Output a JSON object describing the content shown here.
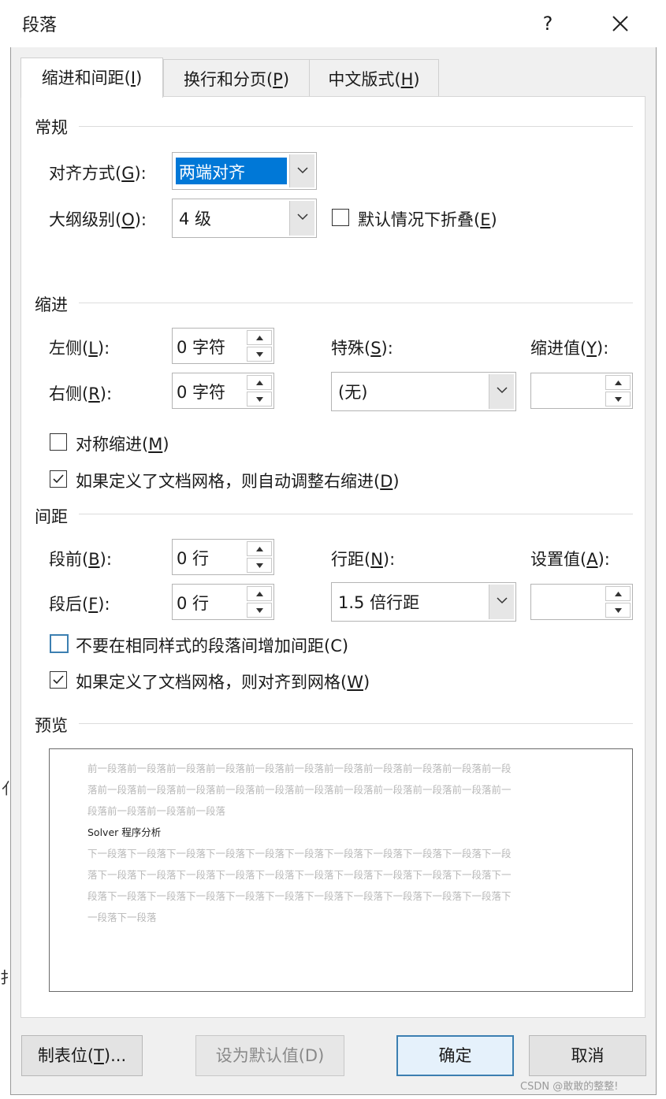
{
  "dialog": {
    "title": "段落",
    "help": "?"
  },
  "tabs": [
    {
      "label": "缩进和间距(",
      "key": "I",
      "end": ")"
    },
    {
      "label": "换行和分页(",
      "key": "P",
      "end": ")"
    },
    {
      "label": "中文版式(",
      "key": "H",
      "end": ")"
    }
  ],
  "general": {
    "section": "常规",
    "alignment_label": "对齐方式(",
    "alignment_key": "G",
    "alignment_end": "):",
    "alignment_value": "两端对齐",
    "outline_label": "大纲级别(",
    "outline_key": "O",
    "outline_end": "):",
    "outline_value": "4 级",
    "collapse_label": "默认情况下折叠(",
    "collapse_key": "E",
    "collapse_end": ")"
  },
  "indent": {
    "section": "缩进",
    "left_label": "左侧(",
    "left_key": "L",
    "left_end": "):",
    "left_value": "0 字符",
    "right_label": "右侧(",
    "right_key": "R",
    "right_end": "):",
    "right_value": "0 字符",
    "special_label": "特殊(",
    "special_key": "S",
    "special_end": "):",
    "special_value": "(无)",
    "by_label": "缩进值(",
    "by_key": "Y",
    "by_end": "):",
    "mirror_label": "对称缩进(",
    "mirror_key": "M",
    "mirror_end": ")",
    "mirror_checked": false,
    "auto_right_label": "如果定义了文档网格，则自动调整右缩进(",
    "auto_right_key": "D",
    "auto_right_end": ")",
    "auto_right_checked": true
  },
  "spacing": {
    "section": "间距",
    "before_label": "段前(",
    "before_key": "B",
    "before_end": "):",
    "before_value": "0 行",
    "after_label": "段后(",
    "after_key": "F",
    "after_end": "):",
    "after_value": "0 行",
    "line_label": "行距(",
    "line_key": "N",
    "line_end": "):",
    "line_value": "1.5 倍行距",
    "at_label": "设置值(",
    "at_key": "A",
    "at_end": "):",
    "no_space_label": "不要在相同样式的段落间增加间距(C)",
    "no_space_checked": false,
    "snap_grid_label": "如果定义了文档网格，则对齐到网格(",
    "snap_grid_key": "W",
    "snap_grid_end": ")",
    "snap_grid_checked": true
  },
  "preview": {
    "section": "预览",
    "lines": [
      "前一段落前一段落前一段落前一段落前一段落前一段落前一段落前一段落前一段落前一段落前一段",
      "落前一段落前一段落前一段落前一段落前一段落前一段落前一段落前一段落前一段落前一段落前一",
      "段落前一段落前一段落前一段落",
      "Solver 程序分析",
      "下一段落下一段落下一段落下一段落下一段落下一段落下一段落下一段落下一段落下一段落下一段",
      "落下一段落下一段落下一段落下一段落下一段落下一段落下一段落下一段落下一段落下一段落下一",
      "段落下一段落下一段落下一段落下一段落下一段落下一段落下一段落下一段落下一段落下一段落下",
      "一段落下一段落"
    ]
  },
  "buttons": {
    "tabs_label": "制表位(",
    "tabs_key": "T",
    "tabs_end": ")...",
    "default": "设为默认值(D)",
    "ok": "确定",
    "cancel": "取消"
  },
  "background": {
    "frag1": "亻",
    "frag2": "扌"
  },
  "watermark": "CSDN @敢敢的整整!"
}
